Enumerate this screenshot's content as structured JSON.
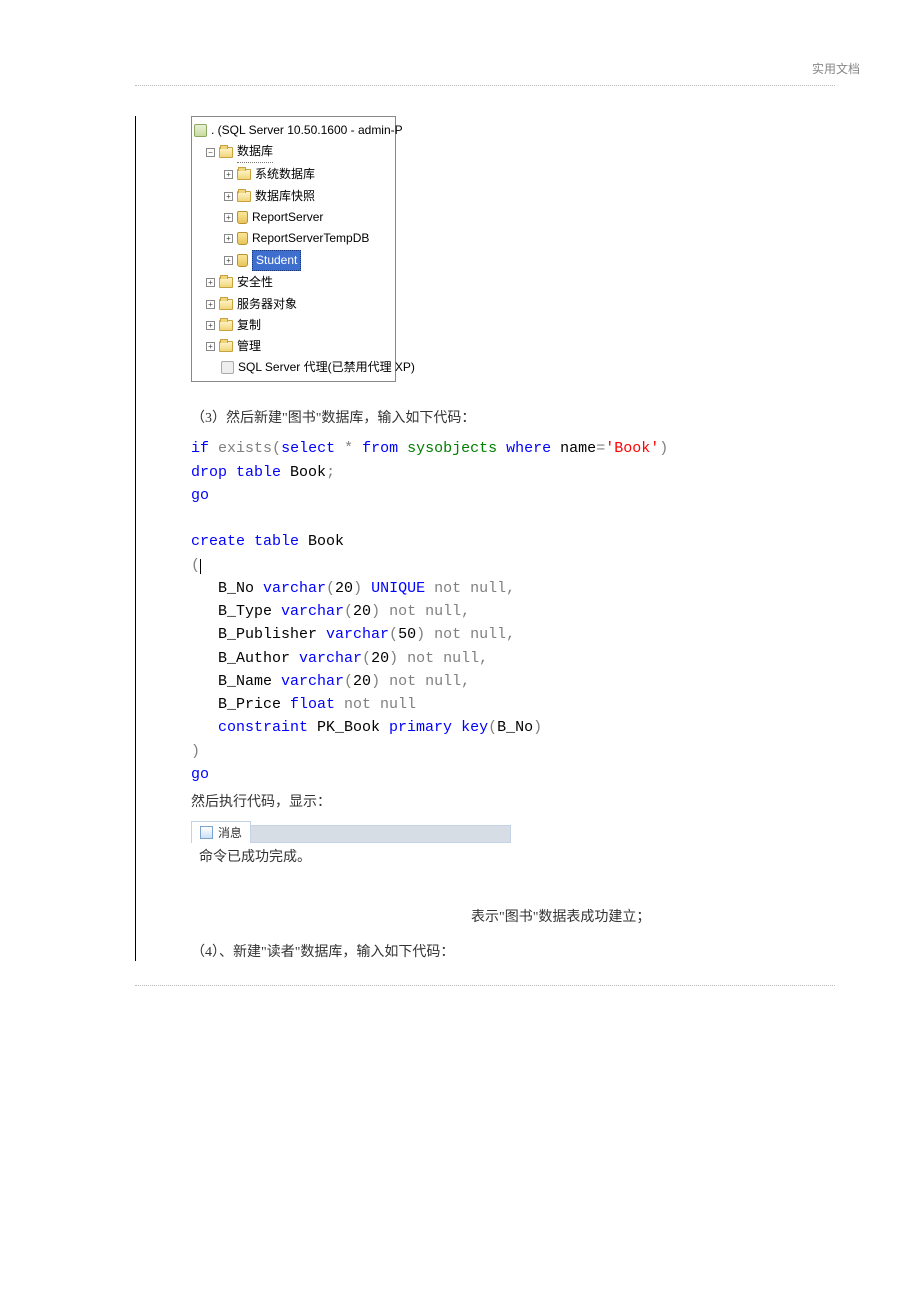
{
  "header": {
    "label": "实用文档"
  },
  "tree": {
    "root": ". (SQL Server 10.50.1600 - admin-P",
    "databases": "数据库",
    "sysdb": "系统数据库",
    "snapshot": "数据库快照",
    "report": "ReportServer",
    "reporttmp": "ReportServerTempDB",
    "student": "Student",
    "security": "安全性",
    "serverobj": "服务器对象",
    "replication": "复制",
    "management": "管理",
    "agent": "SQL Server 代理(已禁用代理 XP)"
  },
  "text": {
    "step3": "（3）然后新建\"图书\"数据库，输入如下代码：",
    "then_exec": "然后执行代码，显示：",
    "result": "表示\"图书\"数据表成功建立；",
    "step4": "（4）、新建\"读者\"数据库，输入如下代码："
  },
  "msg": {
    "tab": "消息",
    "content": "命令已成功完成。"
  },
  "code": {
    "if": "if",
    "exists": "exists",
    "lparen": "(",
    "select": "select",
    "star": " * ",
    "from": "from",
    "sp1": " ",
    "sysobjects": "sysobjects",
    "where": "where",
    "name": " name",
    "eq": "=",
    "bookstr": "'Book'",
    "rparen": ")",
    "drop": "drop",
    "table": "table",
    "book": " Book",
    "semicolon": ";",
    "go": "go",
    "create": "create",
    "bno": "   B_No ",
    "varchar": "varchar",
    "n20": "20",
    "unique": " UNIQUE",
    "notnull": " not null",
    "comma": ",",
    "btype": "   B_Type ",
    "bpub": "   B_Publisher ",
    "n50": "50",
    "bauth": "   B_Author ",
    "bname": "   B_Name ",
    "bprice": "   B_Price ",
    "float": "float",
    "constraint": "constraint",
    "pk": " PK_Book ",
    "primary": "primary",
    "key": "key",
    "bno2": "B_No"
  }
}
